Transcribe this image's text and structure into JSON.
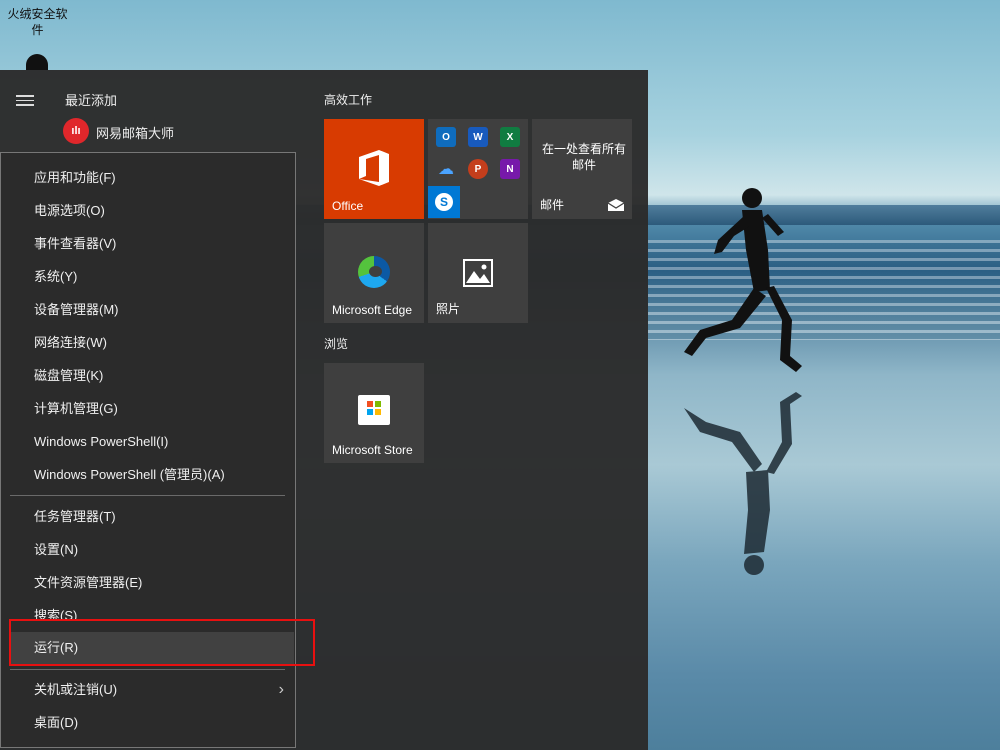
{
  "desktop": {
    "security_label": "火绒安全软件",
    "qq_label": ""
  },
  "start_menu": {
    "recent_title": "最近添加",
    "recent_app": "网易邮箱大师",
    "recent_app_icon": "netease-mail-icon",
    "group_productivity": "高效工作",
    "group_browse": "浏览",
    "tiles": {
      "office": "Office",
      "mail_caption": "在一处查看所有邮件",
      "mail": "邮件",
      "edge": "Microsoft Edge",
      "photos": "照片",
      "store": "Microsoft Store"
    }
  },
  "context_menu": {
    "items": [
      "应用和功能(F)",
      "电源选项(O)",
      "事件查看器(V)",
      "系统(Y)",
      "设备管理器(M)",
      "网络连接(W)",
      "磁盘管理(K)",
      "计算机管理(G)",
      "Windows PowerShell(I)",
      "Windows PowerShell (管理员)(A)",
      "任务管理器(T)",
      "设置(N)",
      "文件资源管理器(E)",
      "搜索(S)",
      "运行(R)",
      "关机或注销(U)",
      "桌面(D)"
    ],
    "highlighted": "运行(R)"
  },
  "colors": {
    "office_orange": "#d83b01",
    "highlight_box": "#e81010",
    "menu_bg": "#2b2b2b"
  }
}
